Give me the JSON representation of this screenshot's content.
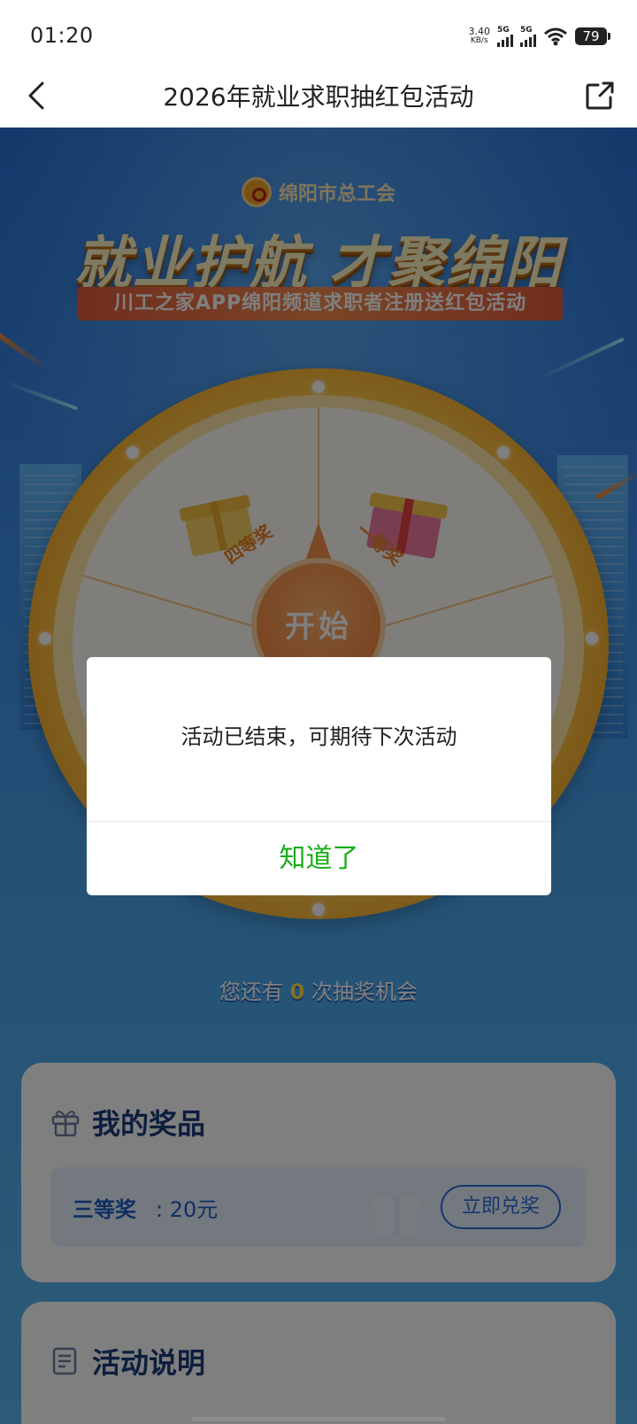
{
  "status_bar": {
    "time": "01:20",
    "net_speed": "3.40",
    "net_unit": "KB/s",
    "sim1": "5G",
    "sim2": "5G",
    "battery": "79"
  },
  "nav": {
    "title": "2026年就业求职抽红包活动",
    "back_icon": "chevron-left-icon",
    "share_icon": "share-icon"
  },
  "banner": {
    "org": "绵阳市总工会",
    "title": "就业护航 才聚绵阳",
    "subtitle": "川工之家APP绵阳频道求职者注册送红包活动"
  },
  "wheel": {
    "prizes": [
      "四等奖",
      "一等奖"
    ],
    "start_label": "开始"
  },
  "chances": {
    "prefix": "您还有",
    "count": "0",
    "suffix": "次抽奖机会"
  },
  "my_prizes": {
    "title": "我的奖品",
    "item_name": "三等奖",
    "item_value": ": 20元",
    "redeem_label": "立即兑奖"
  },
  "rules": {
    "title": "活动说明"
  },
  "dialog": {
    "message": "活动已结束，可期待下次活动",
    "confirm_label": "知道了"
  },
  "colors": {
    "accent_green": "#1aad19",
    "title_blue": "#1a3d7c",
    "wheel_orange": "#f7a623"
  }
}
